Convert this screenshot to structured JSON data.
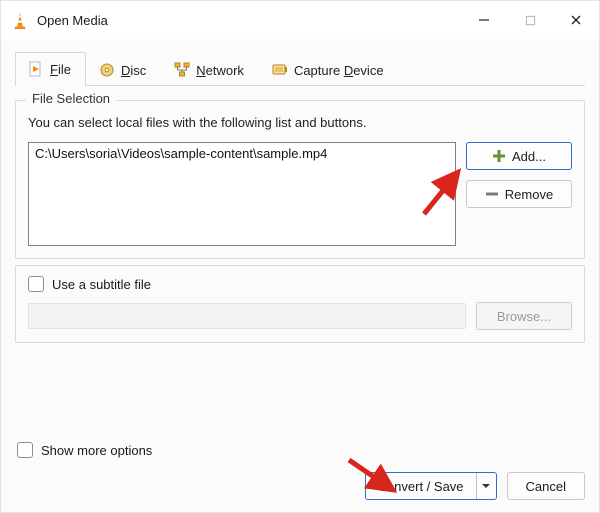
{
  "title": "Open Media",
  "tabs": [
    {
      "label_pre": "",
      "mn": "F",
      "label_post": "ile"
    },
    {
      "label_pre": "",
      "mn": "D",
      "label_post": "isc"
    },
    {
      "label_pre": "",
      "mn": "N",
      "label_post": "etwork"
    },
    {
      "label_pre": "Capture ",
      "mn": "D",
      "label_post": "evice"
    }
  ],
  "file_selection": {
    "title": "File Selection",
    "hint": "You can select local files with the following list and buttons.",
    "files": [
      "C:\\Users\\soria\\Videos\\sample-content\\sample.mp4"
    ],
    "add_label": "Add...",
    "remove_label": "Remove"
  },
  "subtitle": {
    "label": "Use a subtitle file",
    "browse": "Browse..."
  },
  "show_more_pre": "Show ",
  "show_more_mn": "m",
  "show_more_post": "ore options",
  "convert_pre": "C",
  "convert_mn": "o",
  "convert_post": "nvert / Save",
  "cancel_pre": "",
  "cancel_mn": "C",
  "cancel_post": "ancel"
}
